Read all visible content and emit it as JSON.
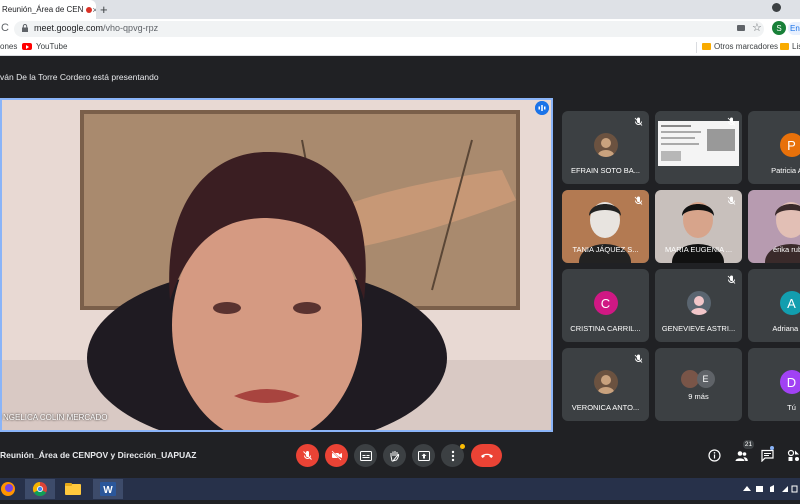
{
  "browser": {
    "tab_title": "Reunión_Área de CEN",
    "tab_close": "×",
    "new_tab": "+",
    "reload": "C",
    "url_host": "meet.google.com",
    "url_path": "/vho-qpvg-rpz",
    "profile_letter": "S",
    "profile_chip": "En",
    "star": "☆",
    "bookmarks": {
      "apps": "ones",
      "youtube": "YouTube",
      "others": "Otros marcadores",
      "list": "Lis"
    }
  },
  "meet": {
    "presenting": "ván De la Torre Cordero está presentando",
    "main_speaker": "NGELICA COLIN MERCADO",
    "meeting_title": "Reunión_Área de CENPOV y Dirección_UAPUAZ",
    "people_count": "21",
    "tiles": [
      {
        "name": "EFRAIN SOTO BA...",
        "kind": "photo",
        "muted": true
      },
      {
        "name": "",
        "kind": "screen",
        "muted": true
      },
      {
        "name": "Patricia Arro",
        "kind": "avatar",
        "letter": "P",
        "color": "#e8710a",
        "muted": false
      },
      {
        "name": "TANIA JÁQUEZ S...",
        "kind": "camera",
        "muted": true
      },
      {
        "name": "MARIA EUGENIA ...",
        "kind": "camera",
        "muted": true
      },
      {
        "name": "érika rubí s",
        "kind": "camera",
        "muted": false
      },
      {
        "name": "CRISTINA CARRIL...",
        "kind": "avatar",
        "letter": "C",
        "color": "#d01884",
        "muted": false
      },
      {
        "name": "GENEVIEVE ASTRI...",
        "kind": "photo",
        "muted": true
      },
      {
        "name": "Adriana Me",
        "kind": "avatar",
        "letter": "A",
        "color": "#129eaf",
        "muted": false
      },
      {
        "name": "VERONICA ANTO...",
        "kind": "photo",
        "muted": true
      },
      {
        "name": "9 más",
        "kind": "more",
        "letter": "E",
        "muted": false
      },
      {
        "name": "Tú",
        "kind": "avatar",
        "letter": "D",
        "color": "#a142f4",
        "muted": false
      }
    ]
  },
  "colors": {
    "meet_bg": "#202124",
    "tile_bg": "#3c4043",
    "active_border": "#8ab4f8",
    "danger": "#ea4335",
    "taskbar": "#27314a"
  }
}
